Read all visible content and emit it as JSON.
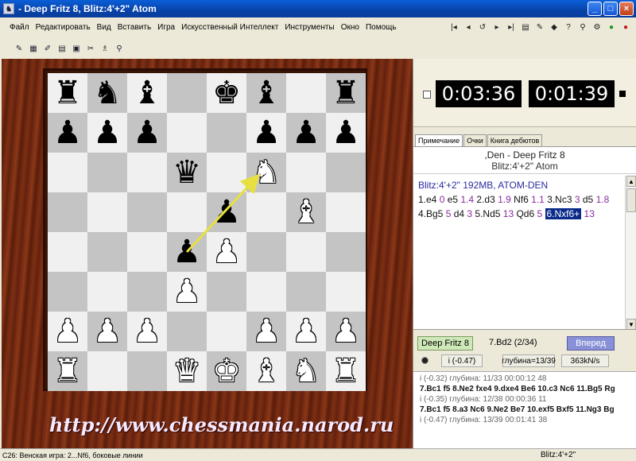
{
  "window": {
    "title": "- Deep Fritz 8, Blitz:4'+2\" Atom",
    "minimize": "_",
    "maximize": "□",
    "close": "×"
  },
  "menu": [
    "Файл",
    "Редактировать",
    "Вид",
    "Вставить",
    "Игра",
    "Искусственный Интеллект",
    "Инструменты",
    "Окно",
    "Помощь"
  ],
  "nav_icons": [
    "|◂",
    "◂",
    "↺",
    "▸",
    "▸|",
    "▤",
    "✎",
    "◆",
    "?",
    "⚲",
    "⚙",
    "●",
    "●"
  ],
  "toolbar_icons": [
    "✎",
    "▦",
    "✐",
    "▤",
    "▣",
    "✂",
    "♗",
    "⚲"
  ],
  "board": {
    "ranks": [
      [
        "br",
        "bn",
        "bb",
        "",
        "bk",
        "bb",
        "",
        "br"
      ],
      [
        "bp",
        "bp",
        "bp",
        "",
        "",
        "bp",
        "bp",
        "bp"
      ],
      [
        "",
        "",
        "",
        "bq",
        "",
        "wn",
        "",
        ""
      ],
      [
        "",
        "",
        "",
        "",
        "bp",
        "",
        "wb",
        ""
      ],
      [
        "",
        "",
        "",
        "bp",
        "wp",
        "",
        "",
        ""
      ],
      [
        "",
        "",
        "",
        "wp",
        "",
        "",
        "",
        ""
      ],
      [
        "wp",
        "wp",
        "wp",
        "",
        "",
        "wp",
        "wp",
        "wp"
      ],
      [
        "wr",
        "",
        "",
        "wq",
        "wk",
        "wb",
        "wn",
        "wr"
      ]
    ],
    "arrow": {
      "from": "d4",
      "to": "f6"
    }
  },
  "watermark": "http://www.chessmania.narod.ru",
  "clocks": {
    "white": "0:03:36",
    "black": "0:01:39"
  },
  "tabs": [
    "Примечание",
    "Очки",
    "Книга дебютов"
  ],
  "notation": {
    "game": ",Den - Deep Fritz 8",
    "event": "Blitz:4'+2\" Atom",
    "header": "Blitz:4'+2\"  192MB, ATOM-DEN",
    "moves": [
      {
        "san": "1.e4",
        "eval": "0"
      },
      {
        "san": "e5",
        "eval": "1.4"
      },
      {
        "san": "2.d3",
        "eval": "1.9"
      },
      {
        "san": "Nf6",
        "eval": "1.1"
      },
      {
        "san": "3.Nc3",
        "eval": "3"
      },
      {
        "san": "d5",
        "eval": "1.8"
      },
      {
        "san": "4.Bg5",
        "eval": "5"
      },
      {
        "san": "d4",
        "eval": "3"
      },
      {
        "san": "5.Nd5",
        "eval": "13"
      },
      {
        "san": "Qd6",
        "eval": "5"
      }
    ],
    "current_move": "6.Nxf6+",
    "current_eval": "13"
  },
  "engine": {
    "name": "Deep Fritz 8",
    "current_move": "7.Bd2 (2/34)",
    "forward_button": "Вперед",
    "eval": "i (-0.47)",
    "depth": "глубина=13/39",
    "speed": "363kN/s",
    "lines": [
      {
        "meta": "i (-0.32)  глубина: 11/33   00:00:12  48",
        "pv": "7.Bc1 f5 8.Ne2 fxe4 9.dxe4 Be6 10.c3 Nc6 11.Bg5 Rg"
      },
      {
        "meta": "i (-0.35)  глубина: 12/38   00:00:36  11",
        "pv": "7.Bc1 f5 8.a3 Nc6 9.Ne2 Be7 10.exf5 Bxf5 11.Ng3 Bg"
      },
      {
        "meta": "i (-0.47)  глубина: 13/39   00:01:41  38",
        "pv": ""
      }
    ]
  },
  "status": {
    "opening": "C26: Венская игра: 2...Nf6, боковые линии",
    "mode": "Blitz:4'+2\""
  }
}
